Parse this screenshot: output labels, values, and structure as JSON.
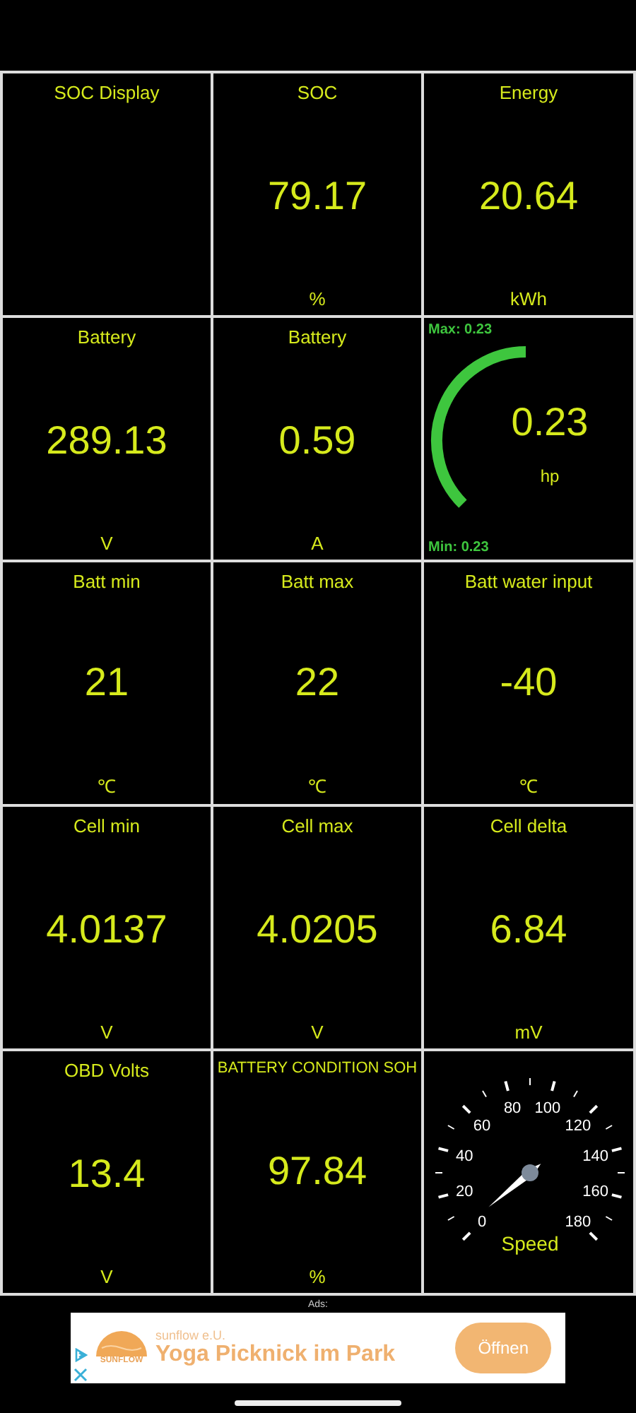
{
  "tiles": [
    {
      "kind": "empty",
      "title": "SOC Display"
    },
    {
      "kind": "value",
      "title": "SOC",
      "value": "79.17",
      "unit": "%"
    },
    {
      "kind": "value",
      "title": "Energy",
      "value": "20.64",
      "unit": "kWh"
    },
    {
      "kind": "value",
      "title": "Battery",
      "value": "289.13",
      "unit": "V"
    },
    {
      "kind": "value",
      "title": "Battery",
      "value": "0.59",
      "unit": "A"
    },
    {
      "kind": "arc",
      "max": "Max: 0.23",
      "min": "Min: 0.23",
      "value": "0.23",
      "unit": "hp"
    },
    {
      "kind": "value",
      "title": "Batt min",
      "value": "21",
      "unit": "℃"
    },
    {
      "kind": "value",
      "title": "Batt max",
      "value": "22",
      "unit": "℃"
    },
    {
      "kind": "value",
      "title": "Batt water input",
      "value": "-40",
      "unit": "℃"
    },
    {
      "kind": "value",
      "title": "Cell min",
      "value": "4.0137",
      "unit": "V"
    },
    {
      "kind": "value",
      "title": "Cell max",
      "value": "4.0205",
      "unit": "V"
    },
    {
      "kind": "value",
      "title": "Cell delta",
      "value": "6.84",
      "unit": "mV"
    },
    {
      "kind": "value",
      "title": "OBD Volts",
      "value": "13.4",
      "unit": "V"
    },
    {
      "kind": "value",
      "title": "BATTERY CONDITION SOH",
      "value": "97.84",
      "unit": "%"
    },
    {
      "kind": "speedometer",
      "scale": [
        "0",
        "20",
        "40",
        "60",
        "80",
        "100",
        "120",
        "140",
        "160",
        "180"
      ],
      "label": "Speed"
    }
  ],
  "ad": {
    "label": "Ads:",
    "logo_text": "SUNFLOW",
    "advertiser": "sunflow e.U.",
    "headline": "Yoga Picknick im Park",
    "button": "Öffnen"
  }
}
